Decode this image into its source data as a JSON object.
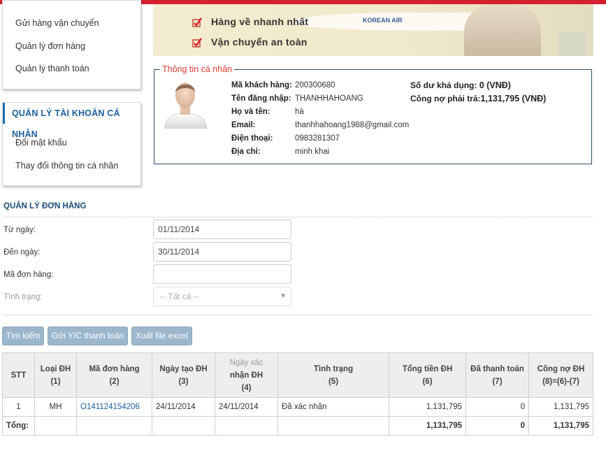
{
  "menu": {
    "items_top": [
      "Gửi hàng vận chuyển",
      "Quản lý đơn hàng",
      "Quản lý thanh toán"
    ],
    "account_title": "QUẢN LÝ TÀI KHOẢN CÁ NHÂN",
    "account_items": [
      "Đổi mật khẩu",
      "Thay đổi thông tin cá nhân"
    ]
  },
  "banner": {
    "line1": "Hàng về nhanh nhất",
    "line2": "Vận chuyển an toàn",
    "airline": "KOREAN AIR"
  },
  "profile": {
    "legend": "Thông tin cá nhân",
    "customer_id_label": "Mã khách hàng:",
    "customer_id": "200300680",
    "username_label": "Tên đăng nhập:",
    "username": "THANHHAHOANG",
    "fullname_label": "Họ và tên:",
    "fullname": "hà",
    "email_label": "Email:",
    "email": "thanhhahoang1988@gmail.com",
    "phone_label": "Điện thoại:",
    "phone": "0983281307",
    "address_label": "Địa chỉ:",
    "address": "minh khai",
    "balance_label": "Số dư khả dụng:",
    "balance": "0 (VNĐ)",
    "debt_label": "Công nợ phải trả:",
    "debt": "1,131,795 (VNĐ)"
  },
  "orders": {
    "title": "QUẢN LÝ ĐƠN HÀNG",
    "from_label": "Từ ngày:",
    "from_value": "01/11/2014",
    "to_label": "Đến ngày:",
    "to_value": "30/11/2014",
    "code_label": "Mã đơn hàng:",
    "code_value": "",
    "status_label": "Tình trạng:",
    "status_value": "-- Tất cả --",
    "btn_search": "Tìm kiếm",
    "btn_payment": "Gửi Y/C thanh toán",
    "btn_excel": "Xuất file excel",
    "columns": [
      [
        "STT"
      ],
      [
        "Loại ĐH",
        "(1)"
      ],
      [
        "Mã đơn hàng",
        "(2)"
      ],
      [
        "Ngày tạo ĐH",
        "(3)"
      ],
      [
        "Ngày xác",
        "nhận ĐH",
        "(4)"
      ],
      [
        "Tình trạng",
        "(5)"
      ],
      [
        "Tổng tiền ĐH",
        "(6)"
      ],
      [
        "Đã thanh toán",
        "(7)"
      ],
      [
        "Công nợ ĐH",
        "(8)=(6)-(7)"
      ]
    ],
    "rows": [
      [
        "1",
        "MH",
        "O141124154206",
        "24/11/2014",
        "24/11/2014",
        "Đã xác nhận",
        "1,131,795",
        "0",
        "1,131,795"
      ]
    ],
    "total_label": "Tổng:",
    "totals": [
      "1,131,795",
      "0",
      "1,131,795"
    ]
  }
}
